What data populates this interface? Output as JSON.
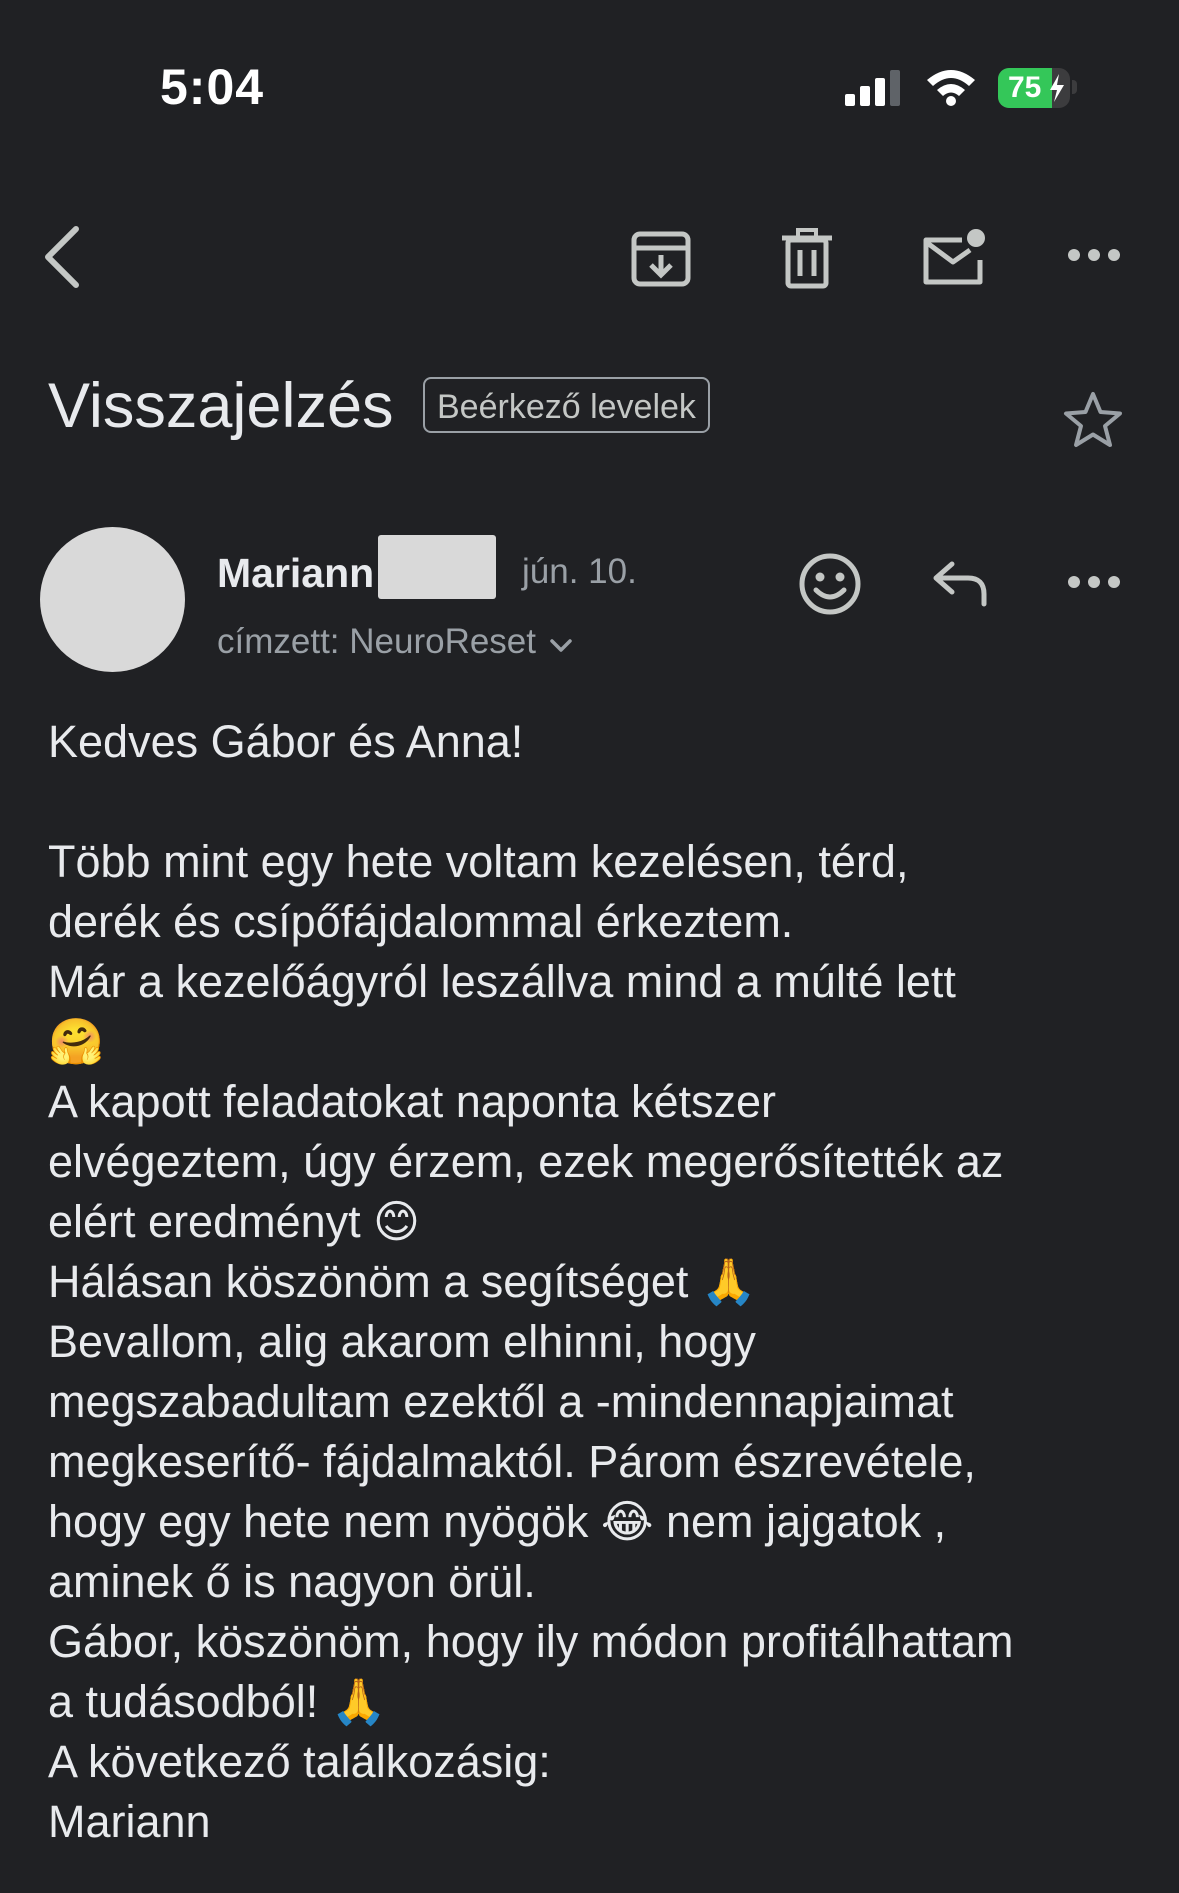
{
  "status_bar": {
    "time": "5:04",
    "battery_percent": "75",
    "battery_level": 0.75,
    "battery_color": "#34c759",
    "signal_icon": "cellular-signal-icon",
    "wifi_icon": "wifi-icon",
    "charging_icon": "bolt-icon"
  },
  "toolbar": {
    "back_icon": "chevron-left-icon",
    "archive_icon": "archive-icon",
    "delete_icon": "trash-icon",
    "mark_unread_icon": "mark-unread-icon",
    "more_icon": "more-horizontal-icon"
  },
  "thread": {
    "subject": "Visszajelzés",
    "label": "Beérkező levelek",
    "star_icon": "star-outline-icon"
  },
  "message": {
    "sender_name": "Mariann",
    "date": "jún. 10.",
    "recipient": "címzett: NeuroReset",
    "emoji_react_icon": "emoji-icon",
    "reply_icon": "reply-icon",
    "more_icon": "more-horizontal-icon",
    "body_lines": [
      "Kedves Gábor és Anna!",
      "",
      "Több mint egy hete voltam kezelésen, térd,",
      "derék és csípőfájdalommal érkeztem.",
      "Már a kezelőágyról leszállva mind a múlté lett",
      "🤗",
      "A kapott feladatokat naponta kétszer",
      "elvégeztem, úgy érzem, ezek megerősítették az",
      "elért eredményt 😊",
      "Hálásan köszönöm a segítséget 🙏",
      "Bevallom, alig akarom elhinni, hogy",
      "megszabadultam ezektől a -mindennapjaimat",
      "megkeserítő- fájdalmaktól. Párom észrevétele,",
      "hogy egy hete nem nyögök 😂 nem jajgatok ,",
      "aminek ő is nagyon örül.",
      "Gábor, köszönöm, hogy ily módon profitálhattam",
      "a tudásodból! 🙏",
      "A következő találkozásig:",
      "Mariann"
    ]
  }
}
